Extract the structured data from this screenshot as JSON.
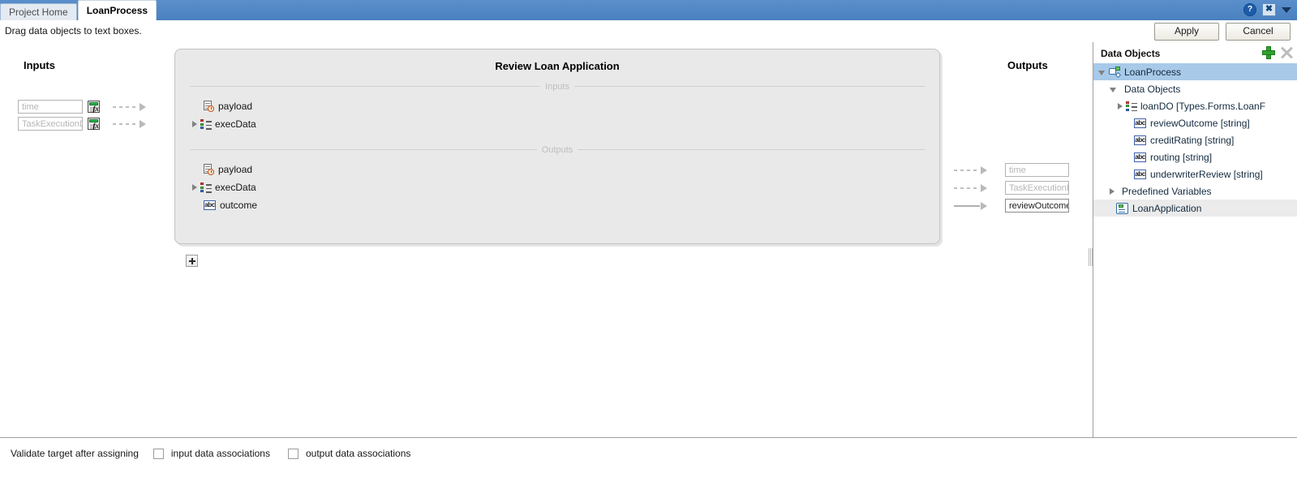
{
  "window": {
    "tabs": [
      {
        "label": "Project Home",
        "active": false
      },
      {
        "label": "LoanProcess",
        "active": true
      }
    ],
    "controls": {
      "help": "?",
      "close": "✖",
      "menu_caret": "▼"
    }
  },
  "hintbar": {
    "message": "Drag data objects to text boxes.",
    "apply_label": "Apply",
    "cancel_label": "Cancel"
  },
  "inputs_column": {
    "title": "Inputs",
    "rows": [
      {
        "value": "",
        "placeholder": "time",
        "fx_icon": "expression-builder-icon",
        "arrow": "dashed"
      },
      {
        "value": "",
        "placeholder": "TaskExecutionDat",
        "fx_icon": "expression-builder-icon",
        "arrow": "dashed"
      }
    ]
  },
  "outputs_column": {
    "title": "Outputs",
    "rows": [
      {
        "value": "",
        "placeholder": "time",
        "arrow": "dashed"
      },
      {
        "value": "",
        "placeholder": "TaskExecutionDat",
        "arrow": "dashed"
      },
      {
        "value": "reviewOutcome",
        "placeholder": "",
        "arrow": "solid"
      }
    ]
  },
  "activity_panel": {
    "title": "Review Loan Application",
    "inputs_divider": "Inputs",
    "outputs_divider": "Outputs",
    "inputs": [
      {
        "label": "payload",
        "icon": "payload-icon",
        "expandable": false
      },
      {
        "label": "execData",
        "icon": "record-list-icon",
        "expandable": true
      }
    ],
    "outputs": [
      {
        "label": "payload",
        "icon": "payload-icon",
        "expandable": false
      },
      {
        "label": "execData",
        "icon": "record-list-icon",
        "expandable": true
      },
      {
        "label": "outcome",
        "icon": "string-abc-icon",
        "expandable": false
      }
    ],
    "add_button_label": "+"
  },
  "data_objects_panel": {
    "title": "Data Objects",
    "add_icon": "add-plus-icon",
    "delete_icon": "delete-x-icon",
    "tree": [
      {
        "label": "LoanProcess",
        "icon": "process-icon",
        "indent": 0,
        "twisty": "down",
        "state": "selected"
      },
      {
        "label": "Data Objects",
        "icon": "none",
        "indent": 1,
        "twisty": "down",
        "state": "none"
      },
      {
        "label": "loanDO [Types.Forms.LoanF",
        "icon": "record-list-icon",
        "indent": 2,
        "twisty": "right",
        "state": "none"
      },
      {
        "label": "reviewOutcome [string]",
        "icon": "string-abc-icon",
        "indent": 2,
        "twisty": "none",
        "state": "none"
      },
      {
        "label": "creditRating [string]",
        "icon": "string-abc-icon",
        "indent": 2,
        "twisty": "none",
        "state": "none"
      },
      {
        "label": "routing [string]",
        "icon": "string-abc-icon",
        "indent": 2,
        "twisty": "none",
        "state": "none"
      },
      {
        "label": "underwriterReview [string]",
        "icon": "string-abc-icon",
        "indent": 2,
        "twisty": "none",
        "state": "none"
      },
      {
        "label": "Predefined Variables",
        "icon": "none",
        "indent": 1,
        "twisty": "right",
        "state": "none"
      },
      {
        "label": "LoanApplication",
        "icon": "application-icon",
        "indent": 0,
        "twisty": "none",
        "state": "soft"
      }
    ]
  },
  "bottom_bar": {
    "lead_label": "Validate target after assigning",
    "checkboxes": [
      {
        "label": "input data associations",
        "checked": false
      },
      {
        "label": "output data associations",
        "checked": false
      }
    ]
  }
}
